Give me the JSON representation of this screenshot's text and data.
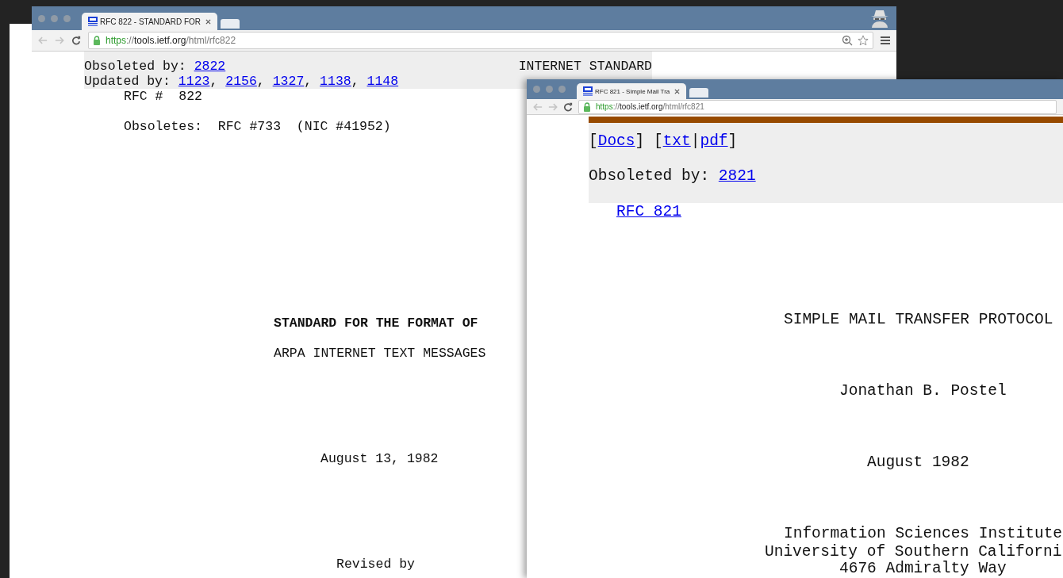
{
  "windows": [
    {
      "tabs": [
        {
          "title": "RFC 822 - STANDARD FOR",
          "selected": true
        }
      ],
      "url": [
        "https",
        "://",
        "tools.ietf.org",
        "/html/rfc822"
      ],
      "header_rows": [
        [
          {
            "kind": "text",
            "text": "Obsoleted by: "
          },
          {
            "kind": "link",
            "text": "2822"
          }
        ],
        [
          {
            "kind": "text",
            "text": "Updated by: "
          },
          {
            "kind": "link",
            "text": "1123"
          },
          {
            "kind": "text",
            "text": ", "
          },
          {
            "kind": "link",
            "text": "2156"
          },
          {
            "kind": "text",
            "text": ", "
          },
          {
            "kind": "link",
            "text": "1327"
          },
          {
            "kind": "text",
            "text": ", "
          },
          {
            "kind": "link",
            "text": "1138"
          },
          {
            "kind": "text",
            "text": ", "
          },
          {
            "kind": "link",
            "text": "1148"
          }
        ]
      ],
      "status": "INTERNET STANDARD",
      "lines": [
        {
          "kind": "text",
          "text": "RFC #  822"
        },
        {
          "kind": "text",
          "text": "Obsoletes:  RFC #733  (NIC #41952)"
        },
        {
          "kind": "bold",
          "text": "STANDARD FOR THE FORMAT OF"
        },
        {
          "kind": "text",
          "text": "ARPA INTERNET TEXT MESSAGES"
        },
        {
          "kind": "text",
          "text": "August 13, 1982"
        },
        {
          "kind": "text",
          "text": "Revised by"
        }
      ]
    },
    {
      "tabs": [
        {
          "title": "RFC 821 - Simple Mail Tra",
          "selected": true
        }
      ],
      "url": [
        "https",
        "://",
        "tools.ietf.org",
        "/html/rfc821"
      ],
      "header_rows": [
        [
          {
            "kind": "text",
            "text": "["
          },
          {
            "kind": "link",
            "text": "Docs"
          },
          {
            "kind": "text",
            "text": "] ["
          },
          {
            "kind": "link",
            "text": "txt"
          },
          {
            "kind": "text",
            "text": "|"
          },
          {
            "kind": "link",
            "text": "pdf"
          },
          {
            "kind": "text",
            "text": "]"
          }
        ],
        [
          {
            "kind": "text",
            "text": "Obsoleted by: "
          },
          {
            "kind": "link",
            "text": "2821"
          }
        ]
      ],
      "lines": [
        {
          "kind": "link",
          "text": "RFC 821"
        },
        {
          "kind": "text",
          "text": "SIMPLE MAIL TRANSFER PROTOCOL"
        },
        {
          "kind": "text",
          "text": "Jonathan B. Postel"
        },
        {
          "kind": "text",
          "text": "August 1982"
        },
        {
          "kind": "text",
          "text": "Information Sciences Institute"
        },
        {
          "kind": "text",
          "text": "University of Southern Californi"
        },
        {
          "kind": "text",
          "text": "4676 Admiralty Way"
        }
      ]
    }
  ]
}
